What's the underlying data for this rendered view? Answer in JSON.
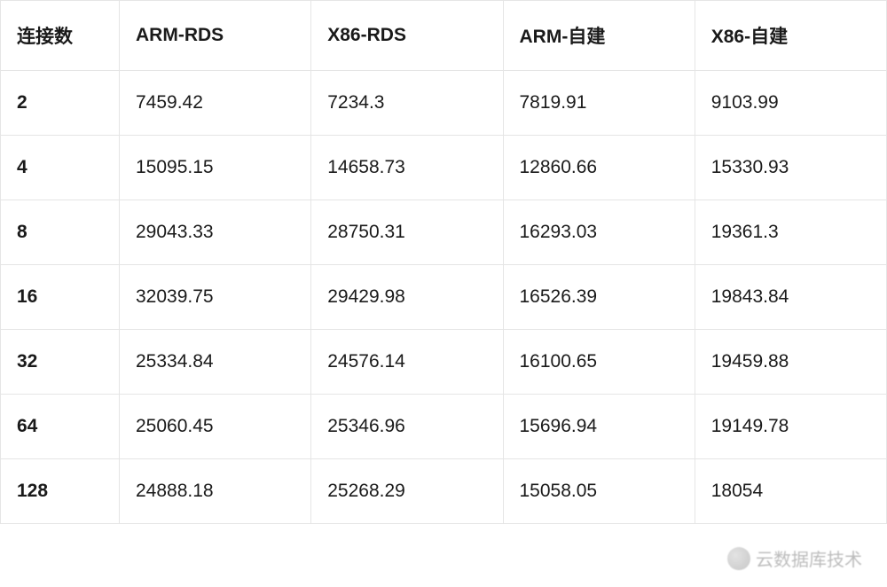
{
  "table": {
    "headers": [
      "连接数",
      "ARM-RDS",
      "X86-RDS",
      "ARM-自建",
      "X86-自建"
    ],
    "rows": [
      [
        "2",
        "7459.42",
        "7234.3",
        "7819.91",
        "9103.99"
      ],
      [
        "4",
        "15095.15",
        "14658.73",
        "12860.66",
        "15330.93"
      ],
      [
        "8",
        "29043.33",
        "28750.31",
        "16293.03",
        "19361.3"
      ],
      [
        "16",
        "32039.75",
        "29429.98",
        "16526.39",
        "19843.84"
      ],
      [
        "32",
        "25334.84",
        "24576.14",
        "16100.65",
        "19459.88"
      ],
      [
        "64",
        "25060.45",
        "25346.96",
        "15696.94",
        "19149.78"
      ],
      [
        "128",
        "24888.18",
        "25268.29",
        "15058.05",
        "18054"
      ]
    ]
  },
  "watermark": {
    "text": "云数据库技术"
  },
  "chart_data": {
    "type": "table",
    "title": "",
    "categories": [
      "2",
      "4",
      "8",
      "16",
      "32",
      "64",
      "128"
    ],
    "xlabel": "连接数",
    "ylabel": "",
    "series": [
      {
        "name": "ARM-RDS",
        "values": [
          7459.42,
          15095.15,
          29043.33,
          32039.75,
          25334.84,
          25060.45,
          24888.18
        ]
      },
      {
        "name": "X86-RDS",
        "values": [
          7234.3,
          14658.73,
          28750.31,
          29429.98,
          24576.14,
          25346.96,
          25268.29
        ]
      },
      {
        "name": "ARM-自建",
        "values": [
          7819.91,
          12860.66,
          16293.03,
          16526.39,
          16100.65,
          15696.94,
          15058.05
        ]
      },
      {
        "name": "X86-自建",
        "values": [
          9103.99,
          15330.93,
          19361.3,
          19843.84,
          19459.88,
          19149.78,
          18054
        ]
      }
    ]
  }
}
